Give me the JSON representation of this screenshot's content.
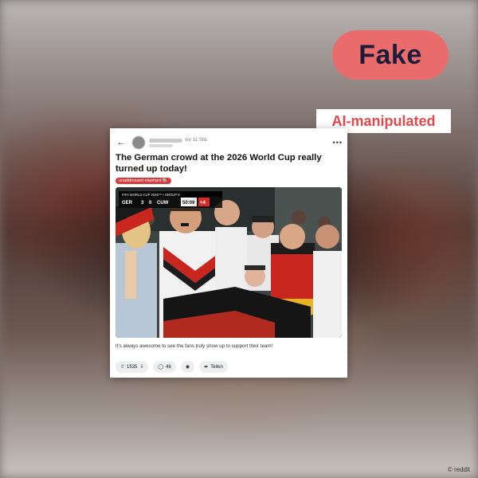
{
  "overlay": {
    "verdict": "Fake",
    "label": "AI-manipulated",
    "verdict_color": "#ea6b6b",
    "label_color": "#e14a4a"
  },
  "post": {
    "time": "vor 11 Std.",
    "title": "The German crowd at the 2026 World Cup really turned up today!",
    "flair": "unaddressed elephant 🐘",
    "flair_color": "#d93a3a",
    "scorebar": {
      "event": "FIFA WORLD CUP 2026™ • GROUP E",
      "home": "GER",
      "home_score": "3",
      "away_score": "0",
      "away": "CUW",
      "clock": "50:09",
      "added": "+4"
    },
    "caption": "It's always awesome to see the fans truly show up to support their team!",
    "actions": {
      "upvotes": "1535",
      "comments": "46",
      "share": "Teilen"
    }
  },
  "watermark": "© reddit"
}
